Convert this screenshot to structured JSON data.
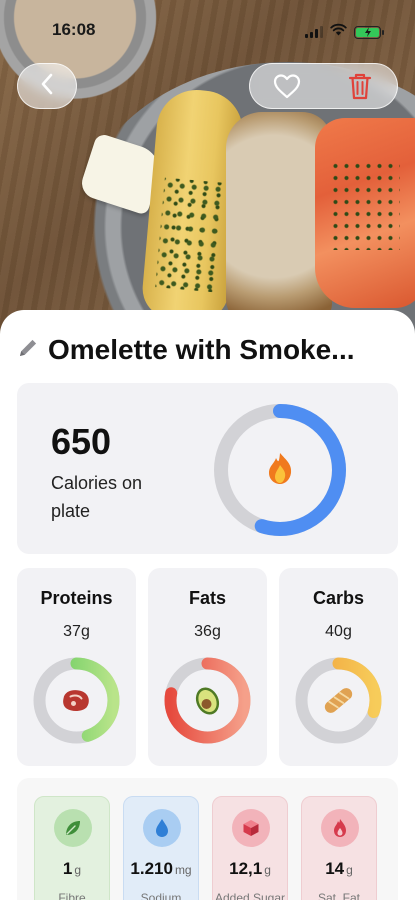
{
  "status_bar": {
    "time": "16:08"
  },
  "meal": {
    "title": "Omelette with Smoke..."
  },
  "calories": {
    "value": "650",
    "label": "Calories on plate",
    "progress": 0.55,
    "ring_color": "#4f8ef2",
    "icon": "fire-icon"
  },
  "macros": [
    {
      "name": "Proteins",
      "value": "37g",
      "progress": 0.45,
      "color_start": "#5cc85a",
      "color_end": "#b9e48a",
      "icon": "steak-icon"
    },
    {
      "name": "Fats",
      "value": "36g",
      "progress": 0.78,
      "color_start": "#e64a3e",
      "color_end": "#f5a08a",
      "icon": "avocado-icon"
    },
    {
      "name": "Carbs",
      "value": "40g",
      "progress": 0.3,
      "color_start": "#f0a03a",
      "color_end": "#f7cc5a",
      "icon": "bread-icon"
    }
  ],
  "micros": [
    {
      "value": "1",
      "unit": "g",
      "label": "Fibre",
      "bg": "#e3f1df",
      "border": "#cfe6c8",
      "badge": "#b9e0b0",
      "icon": "leaf-icon"
    },
    {
      "value": "1.210",
      "unit": "mg",
      "label": "Sodium",
      "bg": "#e1ecf8",
      "border": "#c9dcf2",
      "badge": "#a9cdf2",
      "icon": "drop-icon"
    },
    {
      "value": "12,1",
      "unit": "g",
      "label": "Added Sugar",
      "bg": "#f6e1e3",
      "border": "#efcdd1",
      "badge": "#f2b3ba",
      "icon": "cube-icon"
    },
    {
      "value": "14",
      "unit": "g",
      "label": "Sat. Fat",
      "bg": "#f6e1e3",
      "border": "#efcdd1",
      "badge": "#f2b3ba",
      "icon": "flame-icon"
    }
  ],
  "colors": {
    "accent_red": "#e0423a",
    "card_bg": "#f2f2f5"
  }
}
